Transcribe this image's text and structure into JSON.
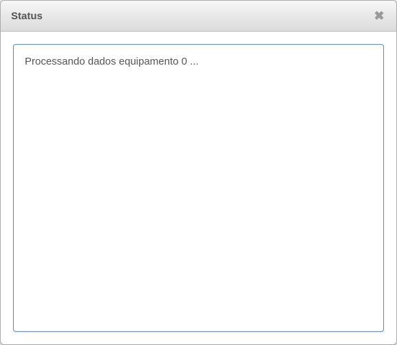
{
  "dialog": {
    "title": "Status",
    "close_label": "✖"
  },
  "status": {
    "message": "Processando dados equipamento 0 ..."
  }
}
